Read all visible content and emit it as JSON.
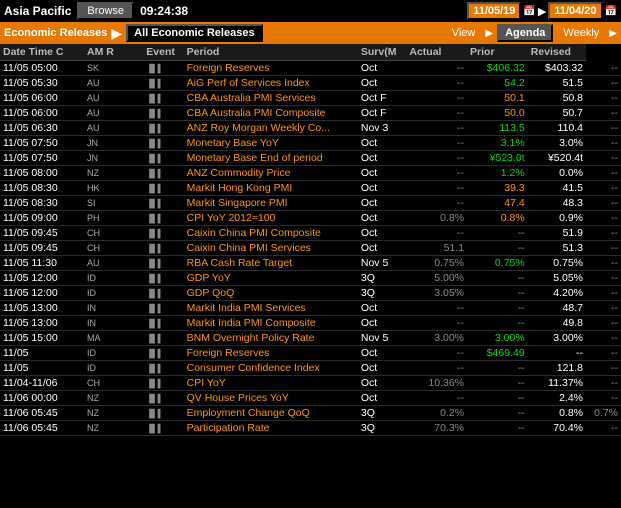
{
  "topBar": {
    "region": "Asia Pacific",
    "browseLabel": "Browse",
    "time": "09:24:38",
    "date1": "11/05/19",
    "date2": "11/04/20"
  },
  "secondBar": {
    "label1": "Economic Releases",
    "separator": "▶",
    "dropdown": "All Economic Releases",
    "viewLabel": "View",
    "agendaLabel": "Agenda",
    "weeklyLabel": "Weekly"
  },
  "headers": {
    "dateTime": "Date Time C",
    "amR": "AM R",
    "event": "Event",
    "period": "Period",
    "surv": "Surv(M",
    "actual": "Actual",
    "prior": "Prior",
    "revised": "Revised"
  },
  "rows": [
    {
      "date": "11/05 05:00",
      "country": "SK",
      "amr": "",
      "chart": "bar",
      "event": "Foreign Reserves",
      "period": "Oct",
      "surv": "--",
      "actual": "$406.32",
      "prior": "$403.32",
      "revised": "--",
      "actualClass": "actual-green"
    },
    {
      "date": "11/05 05:30",
      "country": "AU",
      "amr": "",
      "chart": "bar",
      "event": "AiG Perf of Services Index",
      "period": "Oct",
      "surv": "--",
      "actual": "54.2",
      "prior": "51.5",
      "revised": "--",
      "actualClass": "actual-green"
    },
    {
      "date": "11/05 06:00",
      "country": "AU",
      "amr": "",
      "chart": "bar",
      "event": "CBA Australia PMI Services",
      "period": "Oct F",
      "surv": "--",
      "actual": "50.1",
      "prior": "50.8",
      "revised": "--",
      "actualClass": "actual-orange"
    },
    {
      "date": "11/05 06:00",
      "country": "AU",
      "amr": "",
      "chart": "bar",
      "event": "CBA Australia PMI Composite",
      "period": "Oct F",
      "surv": "--",
      "actual": "50.0",
      "prior": "50.7",
      "revised": "--",
      "actualClass": "actual-orange"
    },
    {
      "date": "11/05 06:30",
      "country": "AU",
      "amr": "",
      "chart": "bar",
      "event": "ANZ Roy Morgan Weekly Co...",
      "period": "Nov 3",
      "surv": "--",
      "actual": "113.5",
      "prior": "110.4",
      "revised": "--",
      "actualClass": "actual-green"
    },
    {
      "date": "11/05 07:50",
      "country": "JN",
      "amr": "",
      "chart": "bar",
      "event": "Monetary Base YoY",
      "period": "Oct",
      "surv": "--",
      "actual": "3.1%",
      "prior": "3.0%",
      "revised": "--",
      "actualClass": "actual-green"
    },
    {
      "date": "11/05 07:50",
      "country": "JN",
      "amr": "",
      "chart": "bar",
      "event": "Monetary Base End of period",
      "period": "Oct",
      "surv": "--",
      "actual": "¥523.0t",
      "prior": "¥520.4t",
      "revised": "--",
      "actualClass": "actual-green"
    },
    {
      "date": "11/05 08:00",
      "country": "NZ",
      "amr": "",
      "chart": "bar",
      "event": "ANZ Commodity Price",
      "period": "Oct",
      "surv": "--",
      "actual": "1.2%",
      "prior": "0.0%",
      "revised": "--",
      "actualClass": "actual-green"
    },
    {
      "date": "11/05 08:30",
      "country": "HK",
      "amr": "",
      "chart": "bar",
      "event": "Markit Hong Kong PMI",
      "period": "Oct",
      "surv": "--",
      "actual": "39.3",
      "prior": "41.5",
      "revised": "--",
      "actualClass": "actual-orange"
    },
    {
      "date": "11/05 08:30",
      "country": "SI",
      "amr": "",
      "chart": "bar",
      "event": "Markit Singapore PMI",
      "period": "Oct",
      "surv": "--",
      "actual": "47.4",
      "prior": "48.3",
      "revised": "--",
      "actualClass": "actual-orange"
    },
    {
      "date": "11/05 09:00",
      "country": "PH",
      "amr": "",
      "chart": "bar",
      "event": "CPI YoY 2012=100",
      "period": "Oct",
      "surv": "0.8%",
      "actual": "0.8%",
      "prior": "0.9%",
      "revised": "--",
      "actualClass": "actual-orange"
    },
    {
      "date": "11/05 09:45",
      "country": "CH",
      "amr": "",
      "chart": "bar",
      "event": "Caixin China PMI Composite",
      "period": "Oct",
      "surv": "--",
      "actual": "--",
      "prior": "51.9",
      "revised": "--",
      "actualClass": "dash"
    },
    {
      "date": "11/05 09:45",
      "country": "CH",
      "amr": "",
      "chart": "bar",
      "event": "Caixin China PMI Services",
      "period": "Oct",
      "surv": "51.1",
      "actual": "--",
      "prior": "51.3",
      "revised": "--",
      "actualClass": "dash"
    },
    {
      "date": "11/05 11:30",
      "country": "AU",
      "amr": "",
      "chart": "bar",
      "event": "RBA Cash Rate Target",
      "period": "Nov 5",
      "surv": "0.75%",
      "actual": "0.75%",
      "prior": "0.75%",
      "revised": "--",
      "actualClass": "actual-green"
    },
    {
      "date": "11/05 12:00",
      "country": "ID",
      "amr": "",
      "chart": "bar",
      "event": "GDP YoY",
      "period": "3Q",
      "surv": "5.00%",
      "actual": "--",
      "prior": "5.05%",
      "revised": "--",
      "actualClass": "dash"
    },
    {
      "date": "11/05 12:00",
      "country": "ID",
      "amr": "",
      "chart": "bar",
      "event": "GDP QoQ",
      "period": "3Q",
      "surv": "3.05%",
      "actual": "--",
      "prior": "4.20%",
      "revised": "--",
      "actualClass": "dash"
    },
    {
      "date": "11/05 13:00",
      "country": "IN",
      "amr": "",
      "chart": "bar",
      "event": "Markit India PMI Services",
      "period": "Oct",
      "surv": "--",
      "actual": "--",
      "prior": "48.7",
      "revised": "--",
      "actualClass": "dash"
    },
    {
      "date": "11/05 13:00",
      "country": "IN",
      "amr": "",
      "chart": "bar",
      "event": "Markit India PMI Composite",
      "period": "Oct",
      "surv": "--",
      "actual": "--",
      "prior": "49.8",
      "revised": "--",
      "actualClass": "dash"
    },
    {
      "date": "11/05 15:00",
      "country": "MA",
      "amr": "",
      "chart": "bar",
      "event": "BNM Overnight Policy Rate",
      "period": "Nov 5",
      "surv": "3.00%",
      "actual": "3.00%",
      "prior": "3.00%",
      "revised": "--",
      "actualClass": "actual-green"
    },
    {
      "date": "11/05",
      "country": "ID",
      "amr": "",
      "chart": "bar",
      "event": "Foreign Reserves",
      "period": "Oct",
      "surv": "--",
      "actual": "$469.49",
      "prior": "--",
      "revised": "--",
      "actualClass": "actual-green"
    },
    {
      "date": "11/05",
      "country": "ID",
      "amr": "",
      "chart": "bar",
      "event": "Consumer Confidence Index",
      "period": "Oct",
      "surv": "--",
      "actual": "--",
      "prior": "121.8",
      "revised": "--",
      "actualClass": "dash"
    },
    {
      "date": "11/04-11/06",
      "country": "CH",
      "amr": "",
      "chart": "bar",
      "event": "CPI YoY",
      "period": "Oct",
      "surv": "10.36%",
      "actual": "--",
      "prior": "11.37%",
      "revised": "--",
      "actualClass": "dash"
    },
    {
      "date": "11/06 00:00",
      "country": "NZ",
      "amr": "",
      "chart": "bar",
      "event": "QV House Prices YoY",
      "period": "Oct",
      "surv": "--",
      "actual": "--",
      "prior": "2.4%",
      "revised": "--",
      "actualClass": "dash"
    },
    {
      "date": "11/06 05:45",
      "country": "NZ",
      "amr": "",
      "chart": "bar",
      "event": "Employment Change QoQ",
      "period": "3Q",
      "surv": "0.2%",
      "actual": "--",
      "prior": "0.8%",
      "revised": "0.7%",
      "actualClass": "dash"
    },
    {
      "date": "11/06 05:45",
      "country": "NZ",
      "amr": "",
      "chart": "bar",
      "event": "Participation Rate",
      "period": "3Q",
      "surv": "70.3%",
      "actual": "--",
      "prior": "70.4%",
      "revised": "--",
      "actualClass": "dash"
    }
  ]
}
